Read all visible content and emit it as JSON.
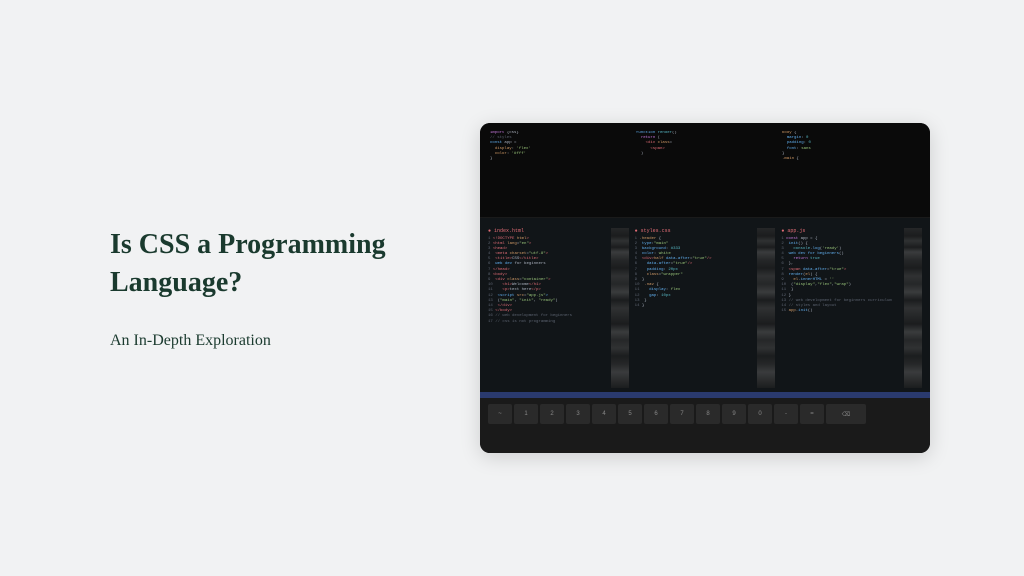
{
  "title": "Is CSS a Programming Language?",
  "subtitle": "An In-Depth Exploration",
  "keyboard_keys": [
    "~",
    "1",
    "2",
    "3",
    "4",
    "5",
    "6",
    "7",
    "8",
    "9",
    "0",
    "-",
    "=",
    "⌫"
  ]
}
